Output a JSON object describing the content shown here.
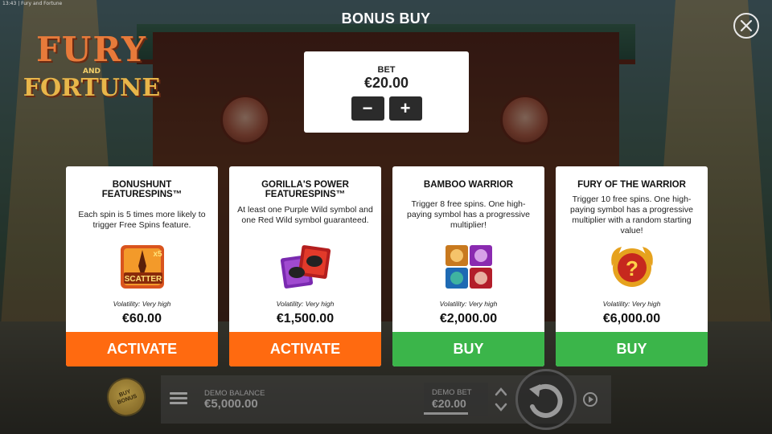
{
  "statusbar": {
    "text": "13:43  |  Fury and Fortune"
  },
  "logo": {
    "line1": "FURY",
    "line2": "AND",
    "line3": "FORTUNE"
  },
  "header": {
    "title": "BONUS BUY"
  },
  "bet": {
    "label": "BET",
    "value": "€20.00",
    "minus": "−",
    "plus": "+"
  },
  "cards": [
    {
      "title": "BONUSHUNT FEATURESPINS™",
      "description": "Each spin is 5 times more likely to trigger Free Spins feature.",
      "icon": "scatter-symbol",
      "icon_text": "SCATTER",
      "icon_multiplier": "x5",
      "volatility": "Volatility: Very high",
      "price": "€60.00",
      "button": "ACTIVATE",
      "button_color": "#ff6a10"
    },
    {
      "title": "GORILLA'S POWER FEATURESPINS™",
      "description": "At least one Purple Wild symbol and one Red Wild symbol guaranteed.",
      "icon": "wild-symbols",
      "volatility": "Volatility: Very high",
      "price": "€1,500.00",
      "button": "ACTIVATE",
      "button_color": "#ff6a10"
    },
    {
      "title": "BAMBOO WARRIOR",
      "description": "Trigger 8 free spins. One high-paying symbol has a progressive multiplier!",
      "icon": "warrior-symbols",
      "volatility": "Volatility: Very high",
      "price": "€2,000.00",
      "button": "BUY",
      "button_color": "#3bb54a"
    },
    {
      "title": "FURY OF THE WARRIOR",
      "description": "Trigger 10 free spins. One high-paying symbol has a progressive multiplier with a random starting value!",
      "icon": "mystery-orb",
      "icon_text": "?",
      "volatility": "Volatility: Very high",
      "price": "€6,000.00",
      "button": "BUY",
      "button_color": "#3bb54a"
    }
  ],
  "bottom": {
    "buy_bonus_line1": "BUY",
    "buy_bonus_line2": "BONUS",
    "demo_balance_label": "DEMO BALANCE",
    "demo_balance_value": "€5,000.00",
    "demo_bet_label": "DEMO BET",
    "demo_bet_value": "€20.00"
  }
}
